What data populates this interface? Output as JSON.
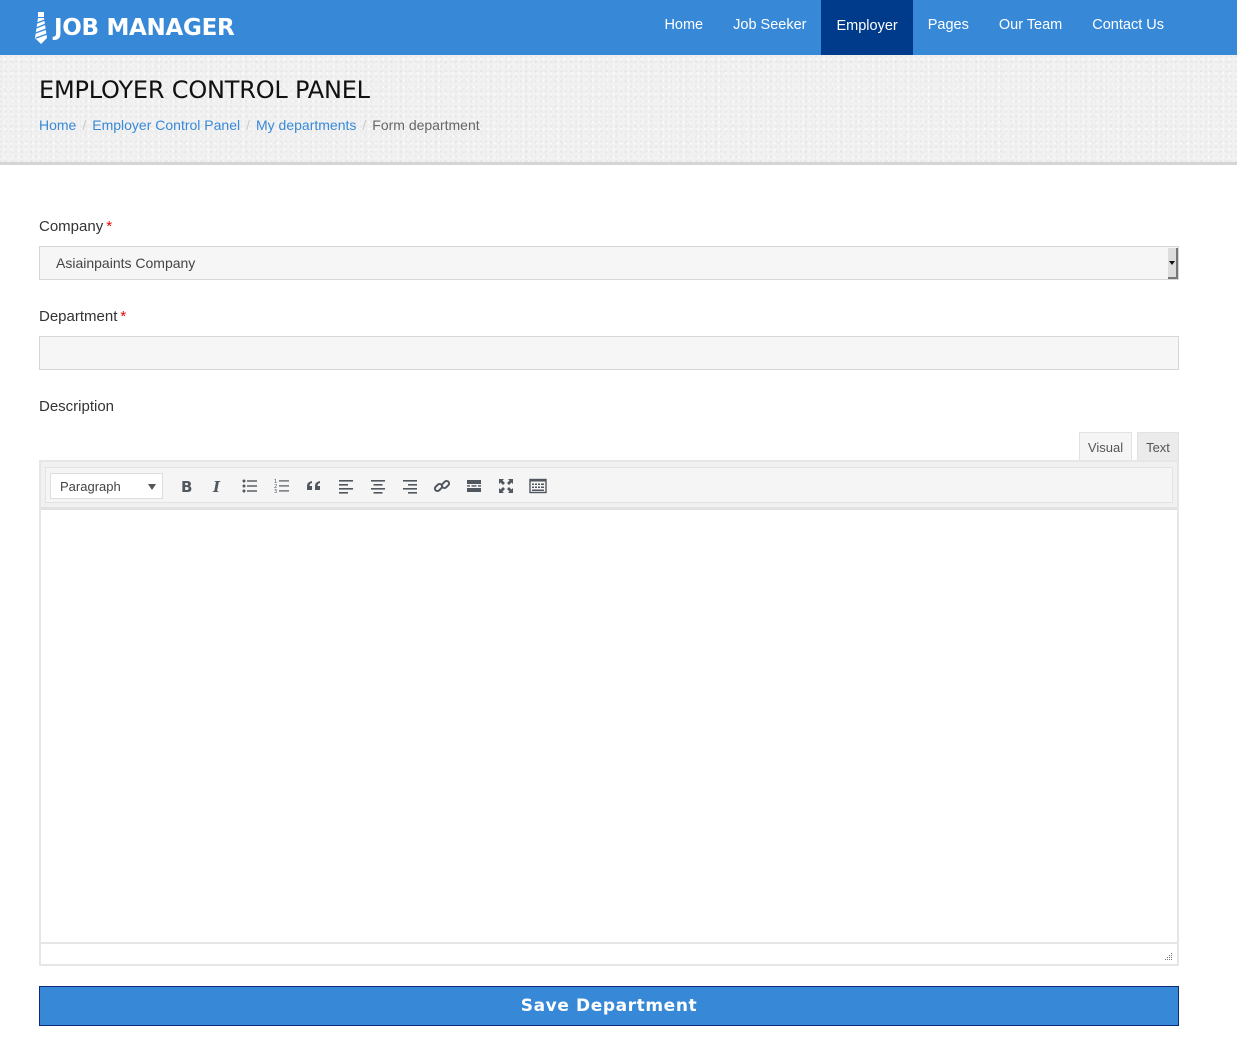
{
  "brand": {
    "name": "JOB MANAGER",
    "icon": "tie-icon"
  },
  "nav": {
    "items": [
      {
        "label": "Home",
        "active": false
      },
      {
        "label": "Job Seeker",
        "active": false
      },
      {
        "label": "Employer",
        "active": true
      },
      {
        "label": "Pages",
        "active": false
      },
      {
        "label": "Our Team",
        "active": false
      },
      {
        "label": "Contact Us",
        "active": false
      }
    ]
  },
  "header": {
    "title": "EMPLOYER CONTROL PANEL",
    "breadcrumb": [
      {
        "label": "Home",
        "link": true
      },
      {
        "label": "Employer Control Panel",
        "link": true
      },
      {
        "label": "My departments",
        "link": true
      },
      {
        "label": "Form department",
        "link": false
      }
    ],
    "separator": "/"
  },
  "form": {
    "company": {
      "label": "Company",
      "required_mark": "*",
      "selected": "Asiainpaints Company"
    },
    "department": {
      "label": "Department",
      "required_mark": "*",
      "value": "",
      "placeholder": ""
    },
    "description": {
      "label": "Description",
      "tabs": {
        "visual": "Visual",
        "text": "Text",
        "active": "Visual"
      },
      "format_select": "Paragraph",
      "toolbar_icons": [
        "bold-icon",
        "italic-icon",
        "bullet-list-icon",
        "numbered-list-icon",
        "blockquote-icon",
        "align-left-icon",
        "align-center-icon",
        "align-right-icon",
        "link-icon",
        "read-more-icon",
        "fullscreen-icon",
        "toolbar-toggle-icon"
      ],
      "content": ""
    },
    "save_label": "Save Department"
  },
  "colors": {
    "accent": "#3789d8",
    "nav_active": "#003a8a",
    "required": "#ee0000"
  }
}
